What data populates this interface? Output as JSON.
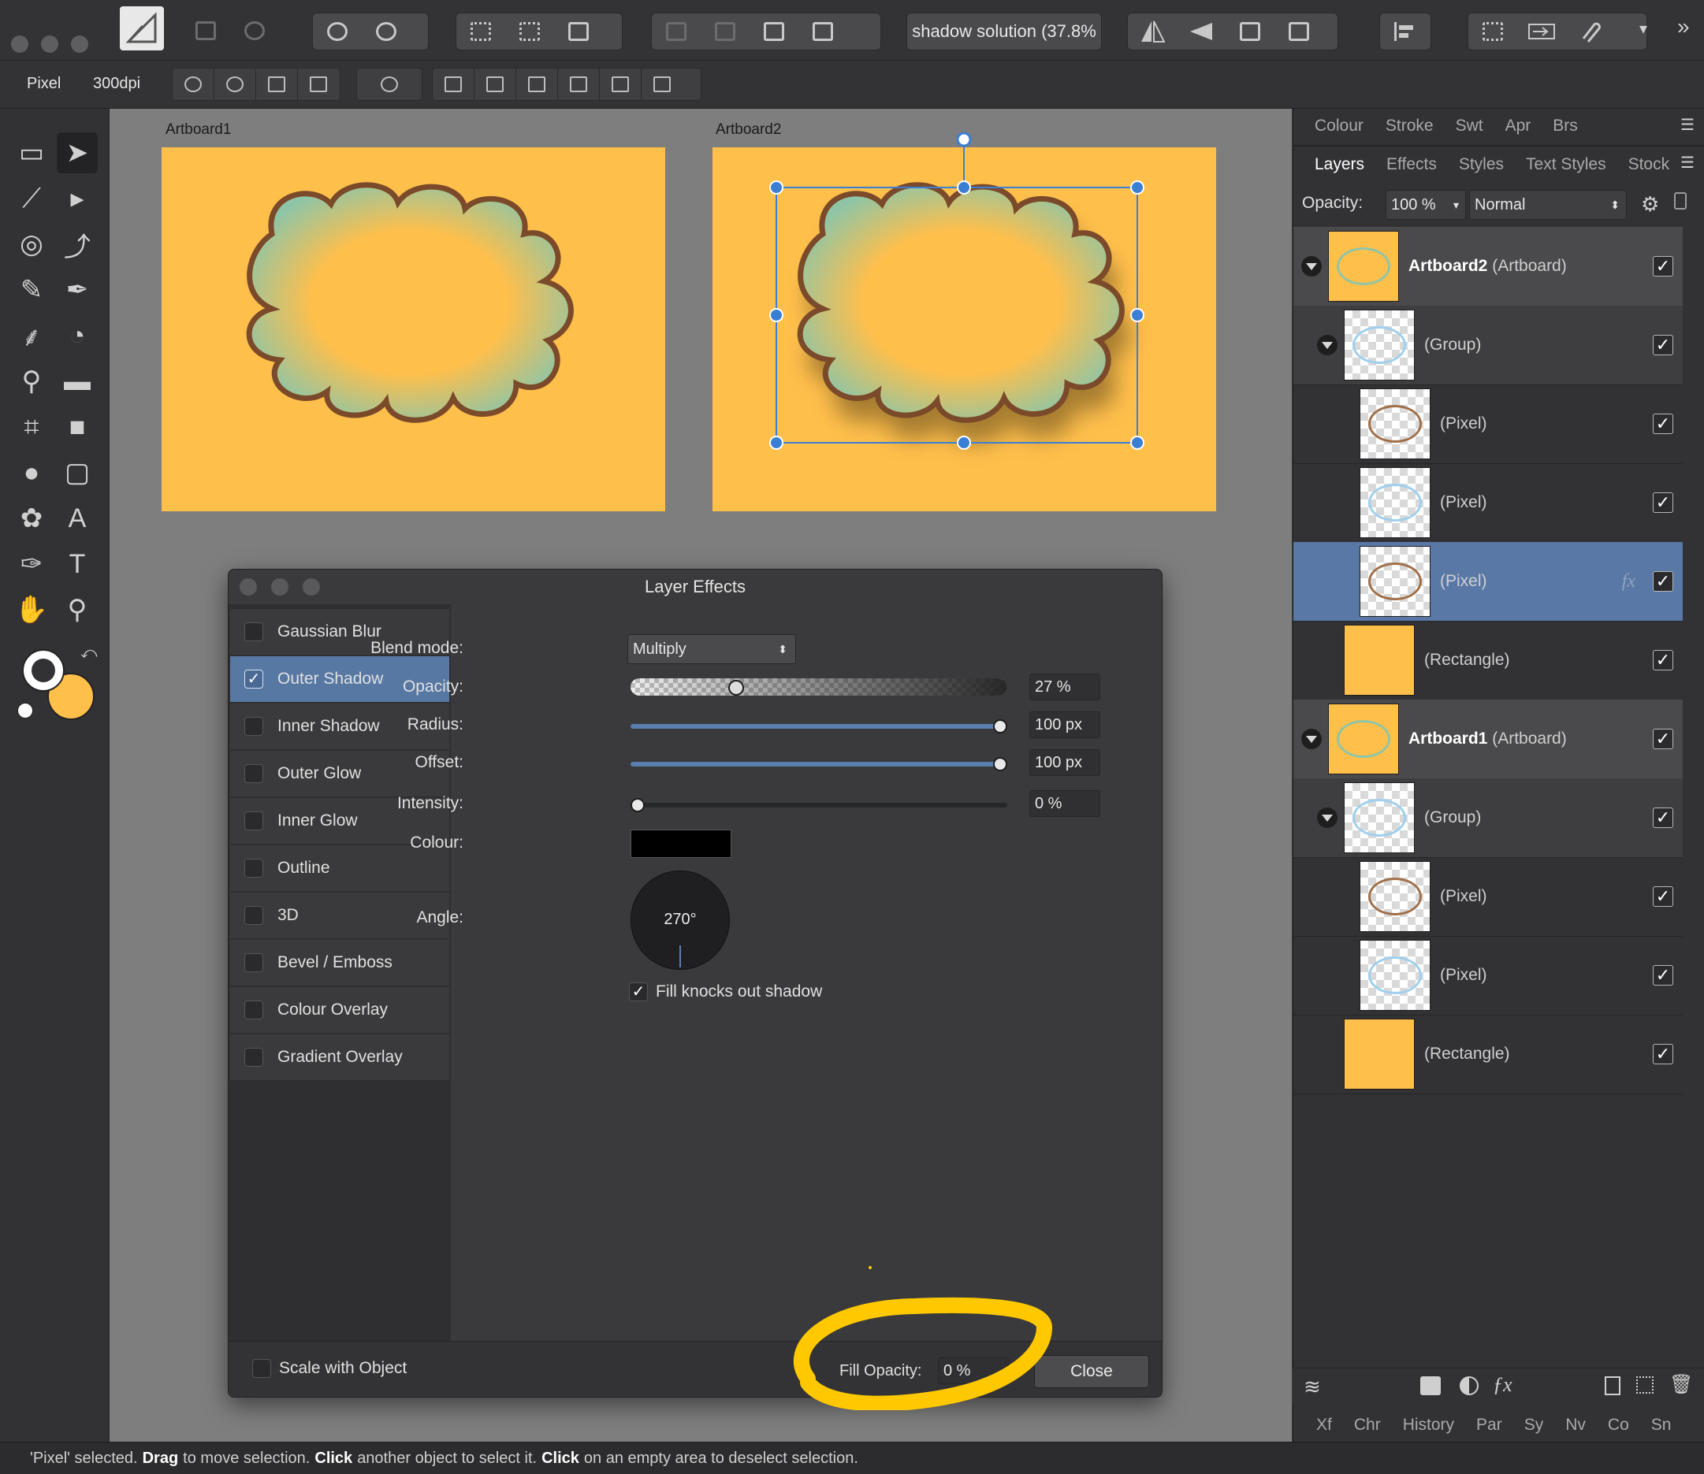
{
  "toolbar": {
    "document_name": "shadow solution (37.8%",
    "overflow": "»"
  },
  "context_toolbar": {
    "unit": "Pixel",
    "dpi": "300dpi"
  },
  "canvas": {
    "artboard1_label": "Artboard1",
    "artboard2_label": "Artboard2",
    "colors": {
      "artboard": "#ffbf4b",
      "shape_outline": "#7a4a2a",
      "shape_edge": "#94c4a4",
      "selection": "#3b7fd4"
    }
  },
  "layer_effects": {
    "title": "Layer Effects",
    "effects": [
      {
        "label": "Gaussian Blur",
        "checked": false
      },
      {
        "label": "Outer Shadow",
        "checked": true,
        "selected": true
      },
      {
        "label": "Inner Shadow",
        "checked": false
      },
      {
        "label": "Outer Glow",
        "checked": false
      },
      {
        "label": "Inner Glow",
        "checked": false
      },
      {
        "label": "Outline",
        "checked": false
      },
      {
        "label": "3D",
        "checked": false
      },
      {
        "label": "Bevel / Emboss",
        "checked": false
      },
      {
        "label": "Colour Overlay",
        "checked": false
      },
      {
        "label": "Gradient Overlay",
        "checked": false
      }
    ],
    "blend_mode_label": "Blend mode:",
    "blend_mode_value": "Multiply",
    "opacity_label": "Opacity:",
    "opacity_value": "27 %",
    "opacity_fraction": 0.27,
    "radius_label": "Radius:",
    "radius_value": "100 px",
    "radius_fraction": 1.0,
    "offset_label": "Offset:",
    "offset_value": "100 px",
    "offset_fraction": 1.0,
    "intensity_label": "Intensity:",
    "intensity_value": "0 %",
    "intensity_fraction": 0.0,
    "colour_label": "Colour:",
    "colour_value": "#000000",
    "angle_label": "Angle:",
    "angle_value": "270°",
    "knockout_label": "Fill knocks out shadow",
    "knockout_checked": true,
    "scale_label": "Scale with Object",
    "fill_opacity_label": "Fill Opacity:",
    "fill_opacity_value": "0 %",
    "close_label": "Close",
    "highlight_color": "#ffc800"
  },
  "right_panel": {
    "top_tabs": [
      "Colour",
      "Stroke",
      "Swt",
      "Apr",
      "Brs"
    ],
    "tabs": [
      "Layers",
      "Effects",
      "Styles",
      "Text Styles",
      "Stock"
    ],
    "active_tab": "Layers",
    "opacity_label": "Opacity:",
    "opacity_value": "100 %",
    "blend_value": "Normal",
    "layers": [
      {
        "name": "Artboard2",
        "type": "(Artboard)",
        "kind": "artboard"
      },
      {
        "name": "",
        "type": "(Group)",
        "kind": "group"
      },
      {
        "name": "",
        "type": "(Pixel)",
        "kind": "pixel"
      },
      {
        "name": "",
        "type": "(Pixel)",
        "kind": "pixel"
      },
      {
        "name": "",
        "type": "(Pixel)",
        "kind": "pixel-selected",
        "fx": "fx"
      },
      {
        "name": "",
        "type": "(Rectangle)",
        "kind": "rect"
      },
      {
        "name": "Artboard1",
        "type": "(Artboard)",
        "kind": "artboard"
      },
      {
        "name": "",
        "type": "(Group)",
        "kind": "group"
      },
      {
        "name": "",
        "type": "(Pixel)",
        "kind": "pixel"
      },
      {
        "name": "",
        "type": "(Pixel)",
        "kind": "pixel"
      },
      {
        "name": "",
        "type": "(Rectangle)",
        "kind": "rect"
      }
    ],
    "bottom_tabs": [
      "Xf",
      "Chr",
      "History",
      "Par",
      "Sy",
      "Nv",
      "Co",
      "Sn"
    ]
  },
  "status": {
    "part1": "'Pixel' selected.",
    "bold1": "Drag",
    "part2": "to move selection.",
    "bold2": "Click",
    "part3": "another object to select it.",
    "bold3": "Click",
    "part4": "on an empty area to deselect selection."
  }
}
